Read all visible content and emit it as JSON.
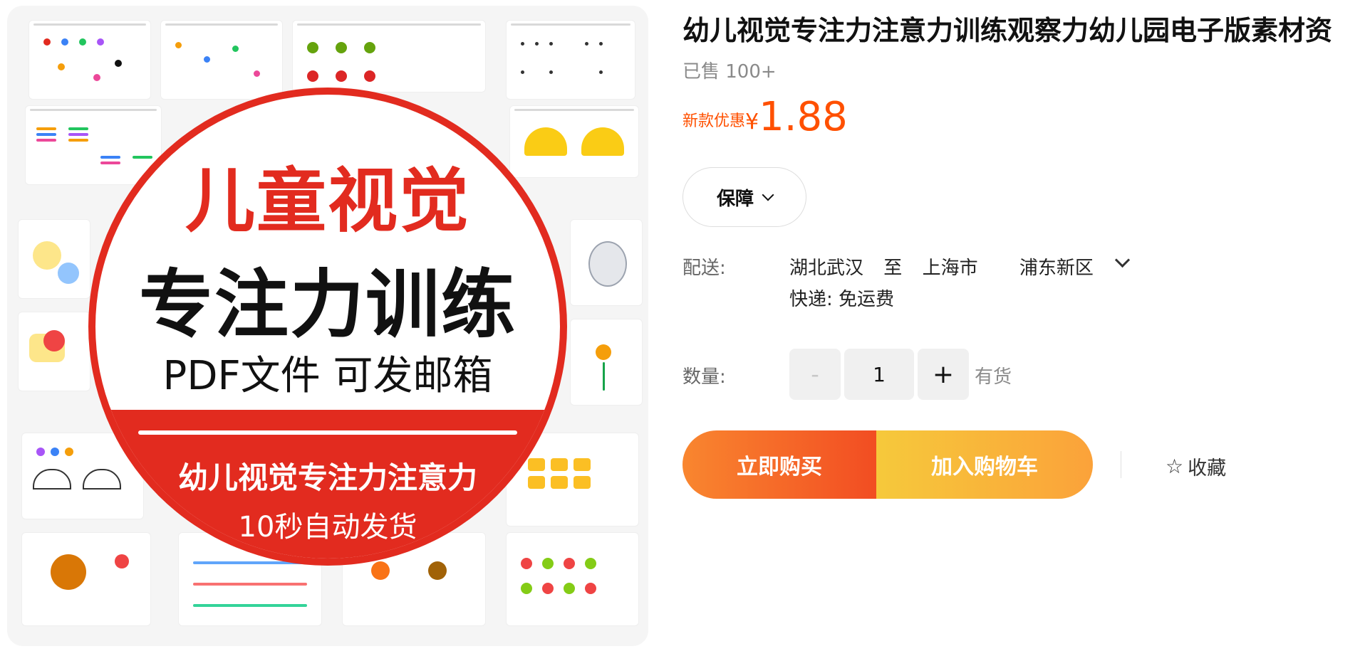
{
  "product": {
    "title": "幼儿视觉专注力注意力训练观察力幼儿园电子版素材资",
    "sold": "已售 100+",
    "price": {
      "promo_label": "新款优惠",
      "currency": "¥",
      "amount": "1.88"
    }
  },
  "image": {
    "line1": "儿童视觉",
    "line2": "专注力训练",
    "line3": "PDF文件 可发邮箱",
    "line4": "幼儿视觉专注力注意力",
    "line5": "10秒自动发货"
  },
  "guarantee": {
    "label": "保障"
  },
  "shipping": {
    "label": "配送:",
    "from": "湖北武汉",
    "to_word": "至",
    "city": "上海市",
    "district": "浦东新区",
    "express": "快递: 免运费"
  },
  "quantity": {
    "label": "数量:",
    "minus": "-",
    "value": "1",
    "plus": "+",
    "stock": "有货"
  },
  "actions": {
    "buy_now": "立即购买",
    "add_to_cart": "加入购物车",
    "favorite": "收藏"
  },
  "colors": {
    "accent": "#ff5000",
    "brand_red": "#e22b1f",
    "cart_yellow": "#fbb03b"
  }
}
